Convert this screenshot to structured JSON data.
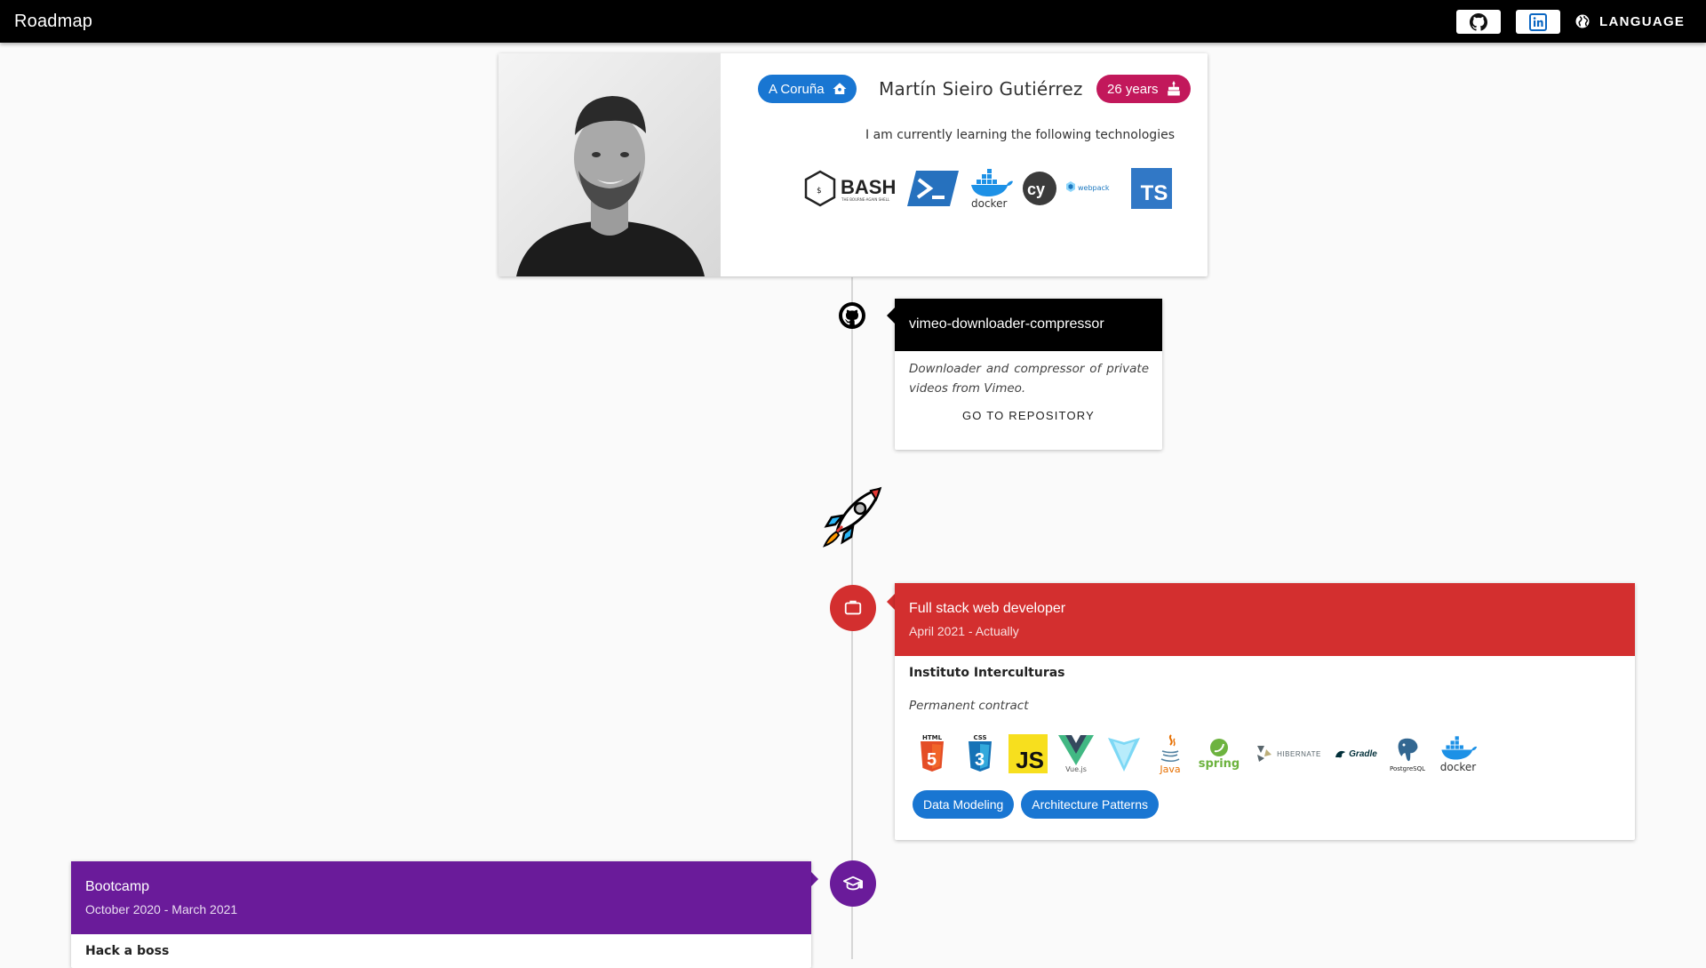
{
  "app": {
    "title": "Roadmap",
    "language_label": "LANGUAGE"
  },
  "icons": {
    "github": "github-icon",
    "linkedin": "linkedin-icon",
    "language": "globe-icon"
  },
  "profile": {
    "location": "A Coruña",
    "name": "Martín Sieiro Gutiérrez",
    "age": "26 years",
    "learning_text": "I am currently learning the following technologies",
    "technologies": [
      "BASH",
      "PowerShell",
      "docker",
      "Cypress",
      "webpack",
      "TS"
    ],
    "colors": {
      "location": "#1976d2",
      "age": "#d81b60"
    }
  },
  "repo_card": {
    "title": "vimeo-downloader-compressor",
    "description": "Downloader and compressor of private videos from Vimeo.",
    "link": "GO TO REPOSITORY"
  },
  "job_card": {
    "title": "Full stack web developer",
    "dates": "April 2021 - Actually",
    "company": "Instituto Interculturas",
    "contract": "Permanent contract",
    "technologies": [
      "HTML",
      "CSS",
      "JS",
      "Vue.js",
      "Vite",
      "Java",
      "spring",
      "HIBERNATE",
      "Gradle",
      "PostgreSQL",
      "docker"
    ],
    "skills": [
      "Data Modeling",
      "Architecture Patterns"
    ],
    "color": "#d32f2f"
  },
  "bootcamp_card": {
    "title": "Bootcamp",
    "dates": "October 2020 - March 2021",
    "school": "Hack a boss",
    "color": "#6a1b9a"
  }
}
